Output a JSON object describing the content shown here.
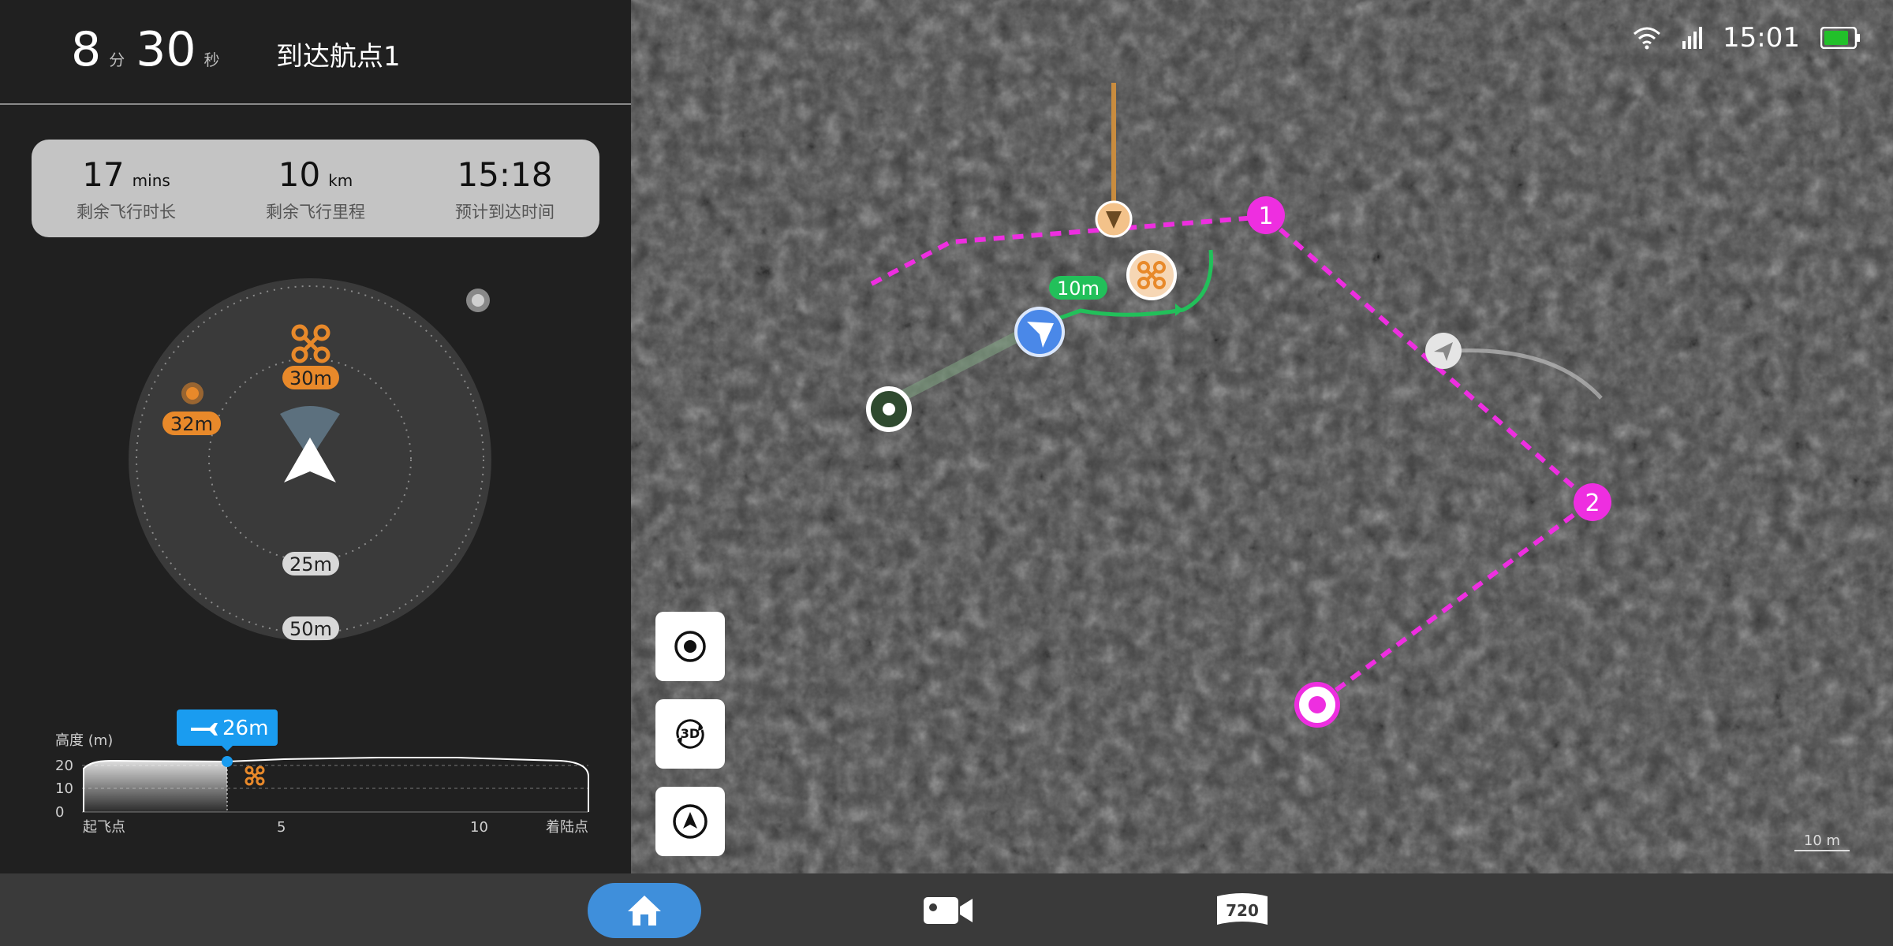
{
  "timer": {
    "minutes": "8",
    "minutes_unit": "分",
    "seconds": "30",
    "seconds_unit": "秒"
  },
  "destination": "到达航点1",
  "stats": [
    {
      "value": "17",
      "unit": "mins",
      "label": "剩余飞行时长"
    },
    {
      "value": "10",
      "unit": "km",
      "label": "剩余飞行里程"
    },
    {
      "value": "15:18",
      "unit": "",
      "label": "预计到达时间"
    }
  ],
  "radar": {
    "drone_label": "30m",
    "poi_label": "32m",
    "ring_inner_label": "25m",
    "ring_outer_label": "50m"
  },
  "altitude_chart": {
    "ylabel": "高度 (m)",
    "yticks": [
      "20",
      "10",
      "0"
    ],
    "xticks": [
      "起飞点",
      "5",
      "10",
      "着陆点"
    ],
    "current_altitude": "26m",
    "colors": {
      "marker": "#1a9cf0",
      "drone": "#e8892a"
    }
  },
  "map": {
    "status": {
      "time": "15:01",
      "battery_color": "#22c02a"
    },
    "distance_label": "10m",
    "waypoints": [
      "1",
      "2"
    ],
    "scale": "10 m",
    "buttons": [
      "locate-icon",
      "3d-view-icon",
      "compass-icon"
    ],
    "colors": {
      "route": "#ee2ee0",
      "flown": "#22c05a",
      "current": "#4a88e8"
    }
  },
  "bottom_nav": {
    "tabs": [
      "home-icon",
      "video-camera-icon",
      "panorama-720-icon"
    ],
    "panorama_label": "720"
  }
}
